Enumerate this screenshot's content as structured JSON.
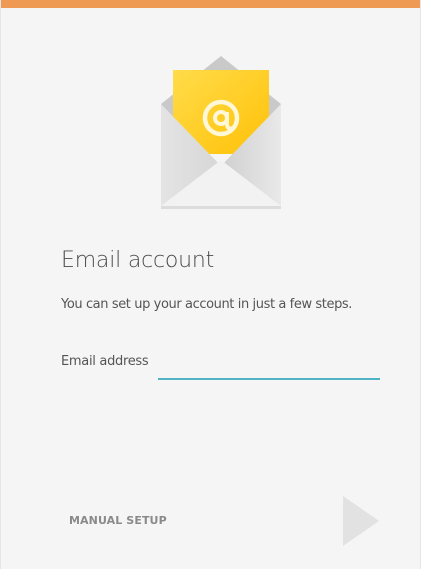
{
  "header": {
    "accent_color": "#ee9a55"
  },
  "app_icon": {
    "name": "email-app-icon"
  },
  "setup": {
    "title": "Email account",
    "subtitle": "You can set up your account in just a few steps.",
    "email_label": "Email address",
    "email_value": "",
    "email_underline_color": "#4fb3c3"
  },
  "footer": {
    "manual_setup_label": "MANUAL SETUP",
    "next_icon": "next-arrow-icon",
    "next_icon_color": "#e0e0e0"
  }
}
